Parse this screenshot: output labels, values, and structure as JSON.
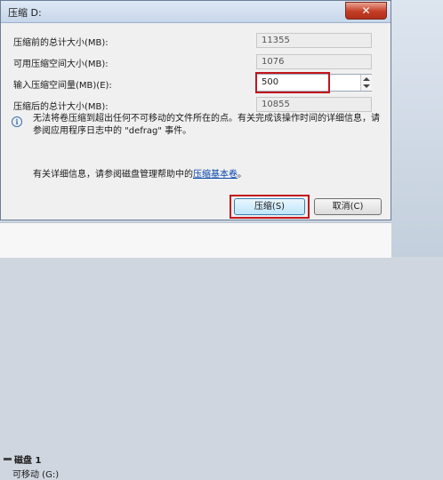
{
  "dialog": {
    "title": "压缩 D:",
    "close_label": "✕",
    "rows": [
      {
        "label": "压缩前的总计大小(MB):",
        "value": "11355"
      },
      {
        "label": "可用压缩空间大小(MB):",
        "value": "1076"
      },
      {
        "label": "输入压缩空间量(MB)(E):",
        "value": "500"
      },
      {
        "label": "压缩后的总计大小(MB):",
        "value": "10855"
      }
    ],
    "info_text": "无法将卷压缩到超出任何不可移动的文件所在的点。有关完成该操作时间的详细信息，请参阅应用程序日志中的 \"defrag\" 事件。",
    "help_text_prefix": "有关详细信息，请参阅磁盘管理帮助中的",
    "help_link": "压缩基本卷",
    "help_text_suffix": "。",
    "primary_button": "压缩(S)",
    "cancel_button": "取消(C)",
    "highlight_color": "#c3161c"
  },
  "background": {
    "disk_label": "磁盘 1",
    "disk_sub": "可移动 (G:)"
  }
}
